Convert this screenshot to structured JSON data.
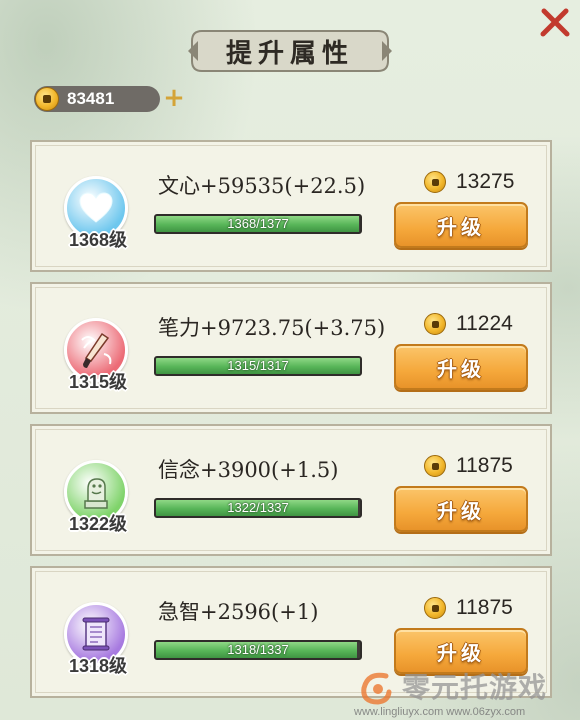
{
  "page": {
    "title": "提升属性"
  },
  "currency": {
    "balance": "83481",
    "add_symbol": "+"
  },
  "attributes": [
    {
      "attr_label": "文心+59535(+22.5)",
      "level_label": "1368级",
      "progress_text": "1368/1377",
      "progress": 0.993,
      "cost": "13275",
      "button_label": "升级",
      "icon": "heart-icon",
      "icon_color": "#6ec7ee"
    },
    {
      "attr_label": "笔力+9723.75(+3.75)",
      "level_label": "1315级",
      "progress_text": "1315/1317",
      "progress": 0.998,
      "cost": "11224",
      "button_label": "升级",
      "icon": "brush-icon",
      "icon_color": "#ec6b76"
    },
    {
      "attr_label": "信念+3900(+1.5)",
      "level_label": "1322级",
      "progress_text": "1322/1337",
      "progress": 0.989,
      "cost": "11875",
      "button_label": "升级",
      "icon": "lion-statue-icon",
      "icon_color": "#7fd36a"
    },
    {
      "attr_label": "急智+2596(+1)",
      "level_label": "1318级",
      "progress_text": "1318/1337",
      "progress": 0.986,
      "cost": "11875",
      "button_label": "升级",
      "icon": "scroll-icon",
      "icon_color": "#a77ae0"
    }
  ],
  "watermark": {
    "brand": "零元托游戏",
    "url": "www.lingliuyx.com   www.06zyx.com"
  }
}
